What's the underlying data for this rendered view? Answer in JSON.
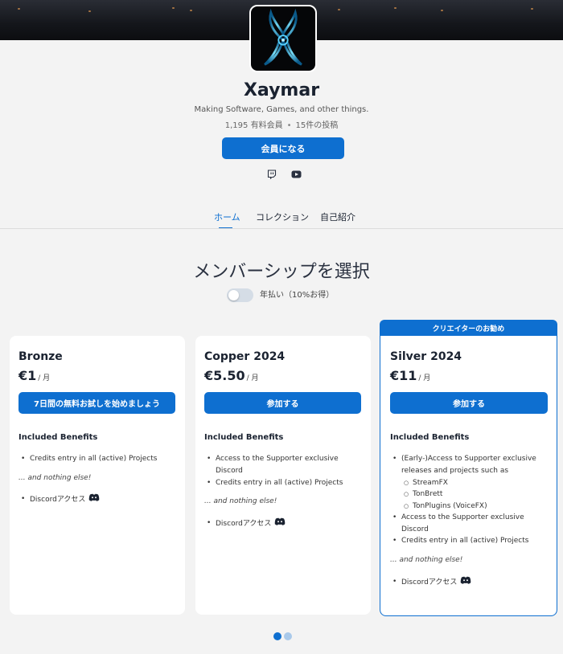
{
  "creator": {
    "name": "Xaymar",
    "tagline": "Making Software, Games, and other things.",
    "members": "1,195 有料会員",
    "posts": "15件の投稿",
    "join_label": "会員になる",
    "social": [
      "twitch-icon",
      "youtube-icon"
    ]
  },
  "tabs": [
    "ホーム",
    "コレクション",
    "自己紹介"
  ],
  "membership": {
    "title": "メンバーシップを選択",
    "toggle_label": "年払い（10%お得）"
  },
  "tiers": [
    {
      "name": "Bronze",
      "price": "€1",
      "period": "/ 月",
      "button": "7日間の無料お試しを始めましょう",
      "benefits_heading": "Included Benefits",
      "benefits": [
        "Credits entry in all (active) Projects"
      ],
      "note": "... and nothing else!",
      "discord": "Discordアクセス"
    },
    {
      "name": "Copper 2024",
      "price": "€5.50",
      "period": "/ 月",
      "button": "参加する",
      "benefits_heading": "Included Benefits",
      "benefits": [
        "Access to the Supporter exclusive",
        "Discord",
        "Credits entry in all (active) Projects"
      ],
      "note": "... and nothing else!",
      "discord": "Discordアクセス"
    },
    {
      "name": "Silver 2024",
      "price": "€11",
      "period": "/ 月",
      "button": "参加する",
      "featured_label": "クリエイターのお勧め",
      "benefits_heading": "Included Benefits",
      "benefits": [
        "(Early-)Access to Supporter exclusive",
        "releases and projects such as",
        "StreamFX",
        "TonBrett",
        "TonPlugins (VoiceFX)",
        "Access to the Supporter exclusive",
        "Discord",
        "Credits entry in all (active) Projects"
      ],
      "note": "... and nothing else!",
      "discord": "Discordアクセス"
    }
  ],
  "colors": {
    "accent": "#0e6fd0",
    "background": "#f3f3f3"
  },
  "pager": {
    "pages": 2,
    "current": 1
  }
}
